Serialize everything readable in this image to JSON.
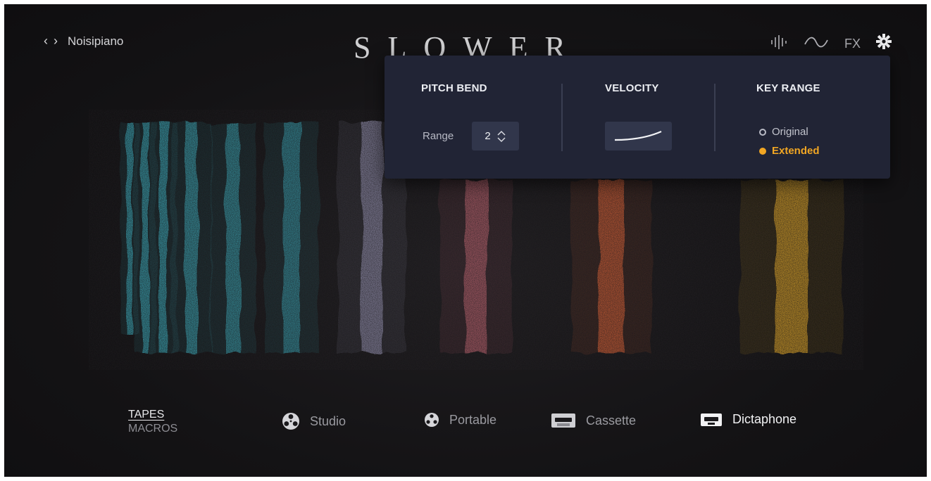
{
  "header": {
    "back_arrow": "‹",
    "forward_arrow": "›",
    "preset_name": "Noisipiano",
    "logo": "SLOWER",
    "icons": [
      "waveform-icon",
      "lfo-wave-icon",
      "fx-label",
      "settings-gear-icon"
    ],
    "fx_label": "FX"
  },
  "settings_panel": {
    "pitch_bend": {
      "title": "PITCH BEND",
      "range_label": "Range",
      "range_value": "2"
    },
    "velocity": {
      "title": "VELOCITY"
    },
    "key_range": {
      "title": "KEY RANGE",
      "options": [
        {
          "label": "Original",
          "selected": false
        },
        {
          "label": "Extended",
          "selected": true
        }
      ]
    }
  },
  "bottom_bar": {
    "view_tabs": [
      {
        "label": "TAPES",
        "active": true
      },
      {
        "label": "MACROS",
        "active": false
      }
    ],
    "tapes": [
      {
        "label": "Studio",
        "icon": "reel-to-reel-icon",
        "selected": false
      },
      {
        "label": "Portable",
        "icon": "small-reel-icon",
        "selected": false
      },
      {
        "label": "Cassette",
        "icon": "cassette-icon",
        "selected": false
      },
      {
        "label": "Dictaphone",
        "icon": "dictaphone-icon",
        "selected": true
      }
    ]
  },
  "colors": {
    "background": "#141315",
    "panel": "#212435",
    "panel_control": "#31364b",
    "accent_selected": "#f1a623",
    "stripe_cyan": "#3fb7c8",
    "stripe_lavender": "#a8a5c8",
    "stripe_pink": "#d9707e",
    "stripe_orange": "#f06a3a",
    "stripe_amber": "#f3b52c"
  }
}
